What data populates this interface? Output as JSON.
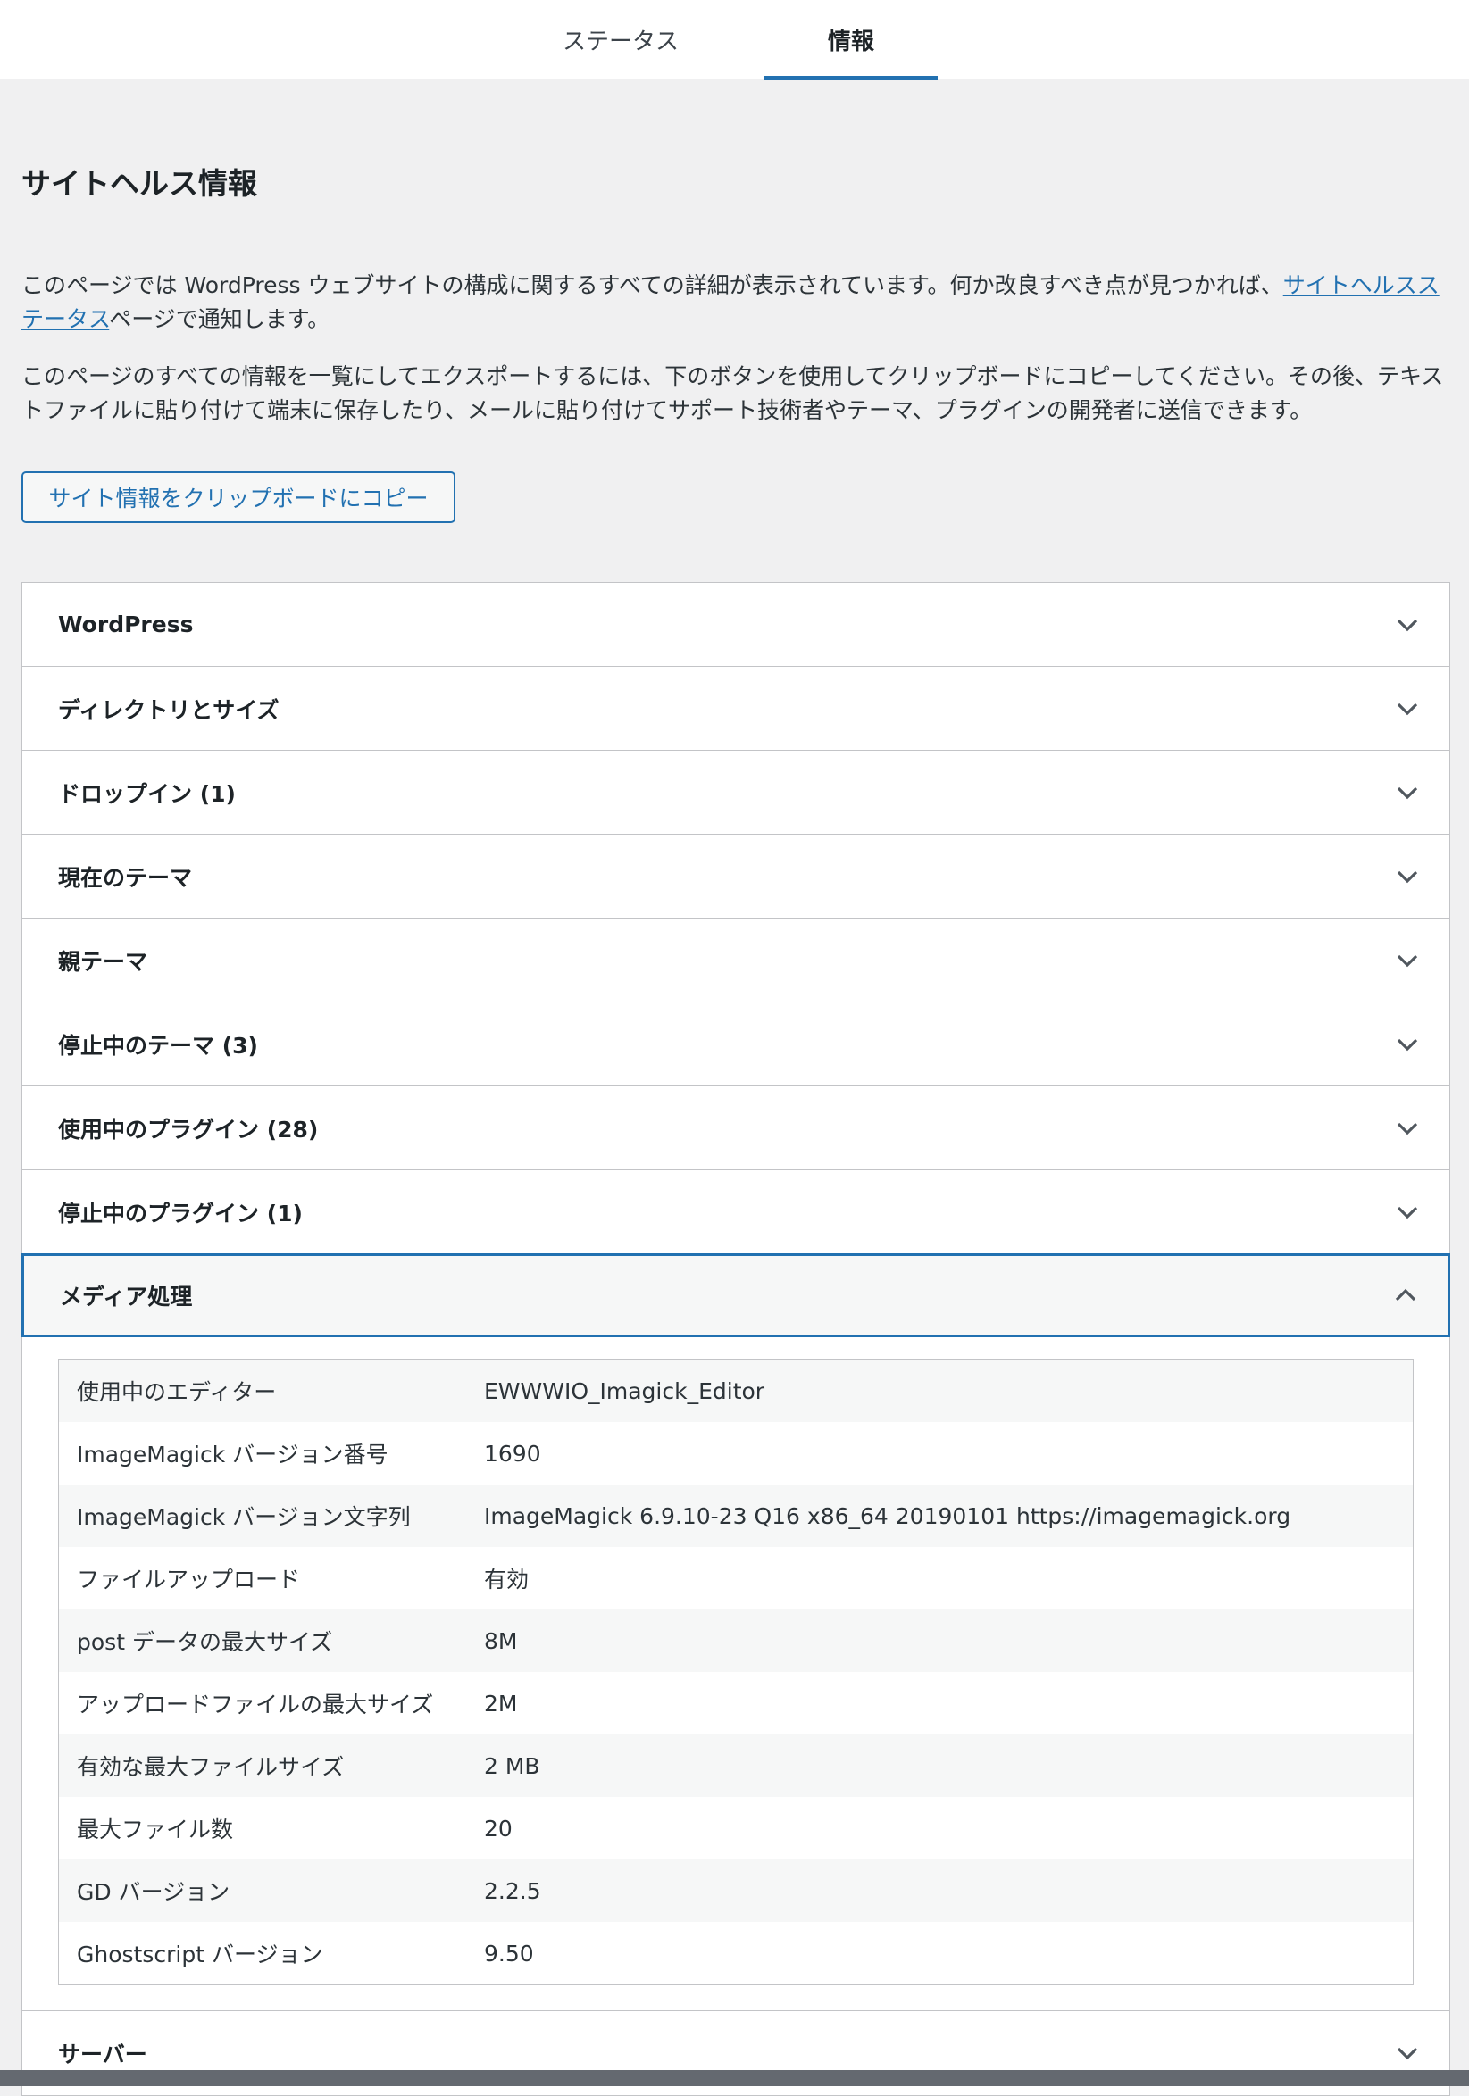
{
  "tabs": {
    "status": "ステータス",
    "info": "情報"
  },
  "page": {
    "title": "サイトヘルス情報",
    "desc1_part1": "このページでは WordPress ウェブサイトの構成に関するすべての詳細が表示されています。何か改良すべき点が見つかれば、",
    "desc1_link": "サイトヘルスステータス",
    "desc1_part2": "ページで通知します。",
    "desc2": "このページのすべての情報を一覧にしてエクスポートするには、下のボタンを使用してクリップボードにコピーしてください。その後、テキストファイルに貼り付けて端末に保存したり、メールに貼り付けてサポート技術者やテーマ、プラグインの開発者に送信できます。",
    "copy_button": "サイト情報をクリップボードにコピー"
  },
  "sections": [
    {
      "label": "WordPress"
    },
    {
      "label": "ディレクトリとサイズ"
    },
    {
      "label": "ドロップイン (1)"
    },
    {
      "label": "現在のテーマ"
    },
    {
      "label": "親テーマ"
    },
    {
      "label": "停止中のテーマ (3)"
    },
    {
      "label": "使用中のプラグイン (28)"
    },
    {
      "label": "停止中のプラグイン (1)"
    },
    {
      "label": "メディア処理"
    },
    {
      "label": "サーバー"
    }
  ],
  "media": {
    "rows": [
      {
        "key": "使用中のエディター",
        "value": "EWWWIO_Imagick_Editor"
      },
      {
        "key": "ImageMagick バージョン番号",
        "value": "1690"
      },
      {
        "key": "ImageMagick バージョン文字列",
        "value": "ImageMagick 6.9.10-23 Q16 x86_64 20190101 https://imagemagick.org"
      },
      {
        "key": "ファイルアップロード",
        "value": "有効"
      },
      {
        "key": "post データの最大サイズ",
        "value": "8M"
      },
      {
        "key": "アップロードファイルの最大サイズ",
        "value": "2M"
      },
      {
        "key": "有効な最大ファイルサイズ",
        "value": "2 MB"
      },
      {
        "key": "最大ファイル数",
        "value": "20"
      },
      {
        "key": "GD バージョン",
        "value": "2.2.5"
      },
      {
        "key": "Ghostscript バージョン",
        "value": "9.50"
      }
    ]
  },
  "icons": {
    "collapsed": "chevron-down-icon",
    "expanded": "chevron-up-icon"
  },
  "colors": {
    "accent": "#2271b1",
    "background": "#f0f0f1"
  }
}
